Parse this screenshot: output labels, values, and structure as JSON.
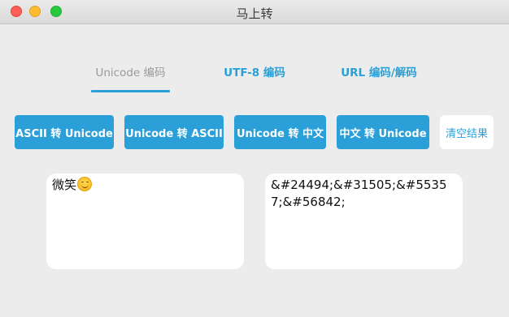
{
  "window": {
    "title": "马上转"
  },
  "tabs": [
    {
      "label": "Unicode 编码",
      "active": true
    },
    {
      "label": "UTF-8 编码",
      "active": false
    },
    {
      "label": "URL 编码/解码",
      "active": false
    }
  ],
  "buttons": {
    "ascii_to_unicode": "ASCII 转 Unicode",
    "unicode_to_ascii": "Unicode 转 ASCII",
    "unicode_to_chinese": "Unicode 转 中文",
    "chinese_to_unicode": "中文 转 Unicode",
    "clear": "清空结果"
  },
  "input": {
    "value": "微笑",
    "emoji": "smiling-face-emoji"
  },
  "output": {
    "value": "&#24494;&#31505;&#55357;&#56842;"
  },
  "colors": {
    "accent": "#2a9fd8",
    "background": "#ececec"
  }
}
